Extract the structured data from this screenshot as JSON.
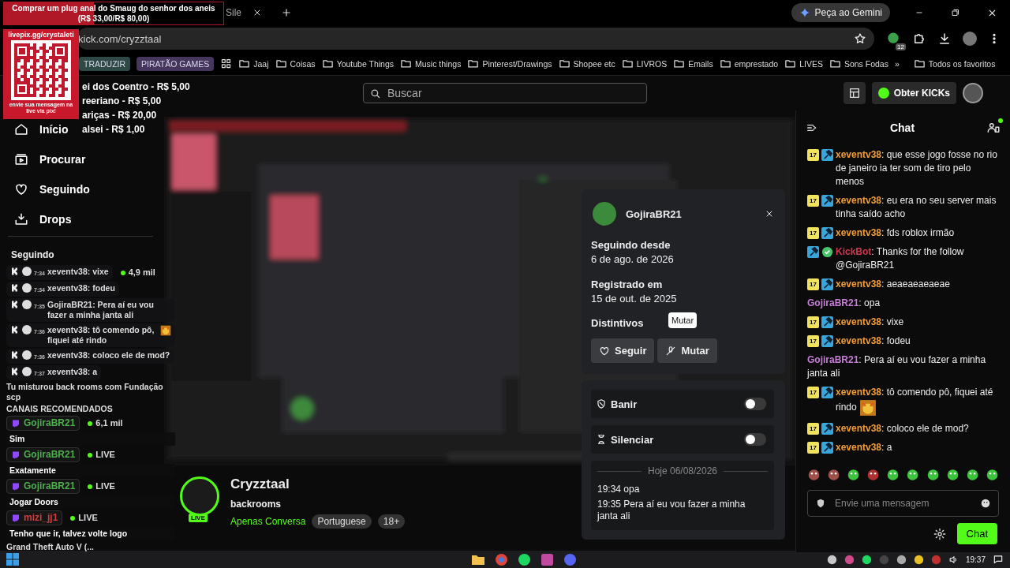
{
  "stream_overlay": {
    "goal": "Comprar um plug anal do Smaug do senhor dos aneis",
    "goal_amount": "(R$ 33,00/R$ 80,00)",
    "level": 0.41,
    "qr_label": "livepix.gg/crystaleti",
    "qr_caption": "envie sua mensagem na live via pix!",
    "donations": [
      "ei dos Coentro - R$ 5,00",
      "reeriano - R$ 5,00",
      "ariças - R$ 20,00",
      "alsei - R$ 1,00"
    ]
  },
  "browser": {
    "tab": {
      "title": "Sile"
    },
    "gemini": "Peça ao Gemini",
    "url": "kick.com/cryzztaal",
    "extension_badge": "12",
    "tags": [
      {
        "label": "TRADUZIR",
        "color": "#2f4a46"
      },
      {
        "label": "PIRATÃO GAMES",
        "color": "#46365e"
      }
    ],
    "folders": [
      "Jaaj",
      "Coisas",
      "Youtube Things",
      "Music things",
      "Pinterest/Drawings",
      "Shopee etc",
      "LIVROS",
      "Emails",
      "emprestado",
      "LIVES",
      "Sons Fodas"
    ],
    "more": "»",
    "all_bookmarks": "Todos os favoritos"
  },
  "header": {
    "search_placeholder": "Buscar",
    "kicks_button": "Obter KICKs"
  },
  "sidebar": {
    "nav": [
      "Início",
      "Procurar",
      "Seguindo",
      "Drops"
    ],
    "section": "Seguindo",
    "feed": [
      {
        "kind": "kick",
        "time": "7:34",
        "text": "xeventv38: vixe",
        "emote": false,
        "side": "4,9 mil"
      },
      {
        "kind": "kick",
        "time": "7:34",
        "text": "xeventv38: fodeu",
        "emote": false
      },
      {
        "kind": "kick",
        "time": "7:35",
        "text": "GojiraBR21: Pera aí eu vou fazer a minha janta ali",
        "emote": false
      },
      {
        "kind": "kick",
        "time": "7:36",
        "text": "xeventv38: tô comendo pô, fiquei até rindo",
        "emote": true
      },
      {
        "kind": "kick",
        "time": "7:36",
        "text": "xeventv38: coloco ele de mod?",
        "emote": false
      },
      {
        "kind": "kick",
        "time": "7:37",
        "text": "xeventv38: a",
        "emote": false
      },
      {
        "kind": "text",
        "text": "Tu misturou back rooms com Fundação scp"
      },
      {
        "kind": "heading",
        "text": "CANAIS RECOMENDADOS"
      },
      {
        "kind": "twitch",
        "user": "GojiraBR21",
        "color": "#4fae4f",
        "text": "Sim",
        "side": "6,1 mil"
      },
      {
        "kind": "twitch",
        "user": "GojiraBR21",
        "color": "#4fae4f",
        "text": "Exatamente",
        "side": "LIVE"
      },
      {
        "kind": "twitch",
        "user": "GojiraBR21",
        "color": "#4fae4f",
        "text": "Jogar Doors",
        "side": "LIVE"
      },
      {
        "kind": "twitch",
        "user": "mizi_jj1",
        "color": "#d23c3c",
        "text": "Tenho que ir, talvez volte logo",
        "side": "LIVE"
      },
      {
        "kind": "text",
        "text": "Grand Theft Auto V (..."
      }
    ]
  },
  "channel": {
    "name": "Cryzztaal",
    "live": "LIVE",
    "title": "backrooms",
    "category": "Apenas Conversa",
    "tags": [
      "Portuguese",
      "18+"
    ]
  },
  "user_card": {
    "username": "GojiraBR21",
    "details": [
      {
        "label": "Seguindo desde",
        "value": "6 de ago. de 2026"
      },
      {
        "label": "Registrado em",
        "value": "15 de out. de 2025"
      }
    ],
    "badges_label": "Distintivos",
    "tooltip": "Mutar",
    "buttons": [
      {
        "label": "Seguir",
        "kind": "follow"
      },
      {
        "label": "Mutar",
        "kind": "mute"
      }
    ],
    "moderation": [
      {
        "label": "Banir",
        "kind": "ban",
        "on": false
      },
      {
        "label": "Silenciar",
        "kind": "timeout",
        "on": false
      }
    ],
    "log": {
      "date": "Hoje 06/08/2026",
      "entries": [
        "19:34 opa",
        "19:35 Pera aí eu vou fazer a minha janta ali"
      ]
    }
  },
  "chat": {
    "title": "Chat",
    "messages": [
      {
        "badges": [
          {
            "kind": "sub",
            "label": "17"
          },
          {
            "kind": "mod"
          }
        ],
        "user": "xeventv38",
        "color": "#f29d38",
        "text": ": que esse jogo fosse no rio de janeiro ia ter som de tiro pelo menos",
        "emote": false
      },
      {
        "badges": [
          {
            "kind": "sub",
            "label": "17"
          },
          {
            "kind": "mod"
          }
        ],
        "user": "xeventv38",
        "color": "#f29d38",
        "text": ": eu era no seu server mais tinha saído acho",
        "emote": false
      },
      {
        "badges": [
          {
            "kind": "sub",
            "label": "17"
          },
          {
            "kind": "mod"
          }
        ],
        "user": "xeventv38",
        "color": "#f29d38",
        "text": ": fds roblox irmão",
        "emote": false
      },
      {
        "badges": [
          {
            "kind": "mod"
          },
          {
            "kind": "verified"
          }
        ],
        "user": "KickBot",
        "color": "#d0364e",
        "text": ": Thanks for the follow @GojiraBR21",
        "emote": false
      },
      {
        "badges": [
          {
            "kind": "sub",
            "label": "17"
          },
          {
            "kind": "mod"
          }
        ],
        "user": "xeventv38",
        "color": "#f29d38",
        "text": ": aeaeaeaeaeae",
        "emote": false
      },
      {
        "user": "GojiraBR21",
        "color": "#c77dd6",
        "text": ": opa",
        "emote": false
      },
      {
        "badges": [
          {
            "kind": "sub",
            "label": "17"
          },
          {
            "kind": "mod"
          }
        ],
        "user": "xeventv38",
        "color": "#f29d38",
        "text": ": vixe",
        "emote": false
      },
      {
        "badges": [
          {
            "kind": "sub",
            "label": "17"
          },
          {
            "kind": "mod"
          }
        ],
        "user": "xeventv38",
        "color": "#f29d38",
        "text": ": fodeu",
        "emote": false
      },
      {
        "user": "GojiraBR21",
        "color": "#c77dd6",
        "text": ": Pera aí eu vou fazer a minha janta ali",
        "emote": false
      },
      {
        "badges": [
          {
            "kind": "sub",
            "label": "17"
          },
          {
            "kind": "mod"
          }
        ],
        "user": "xeventv38",
        "color": "#f29d38",
        "text": ": tô comendo pô, fiquei até rindo",
        "emote": true
      },
      {
        "badges": [
          {
            "kind": "sub",
            "label": "17"
          },
          {
            "kind": "mod"
          }
        ],
        "user": "xeventv38",
        "color": "#f29d38",
        "text": ": coloco ele de mod?",
        "emote": false
      },
      {
        "badges": [
          {
            "kind": "sub",
            "label": "17"
          },
          {
            "kind": "mod"
          }
        ],
        "user": "xeventv38",
        "color": "#f29d38",
        "text": ": a",
        "emote": false
      }
    ],
    "input_placeholder": "Envie uma mensagem",
    "send_button": "Chat"
  },
  "taskbar": {
    "clock": "19:37"
  }
}
